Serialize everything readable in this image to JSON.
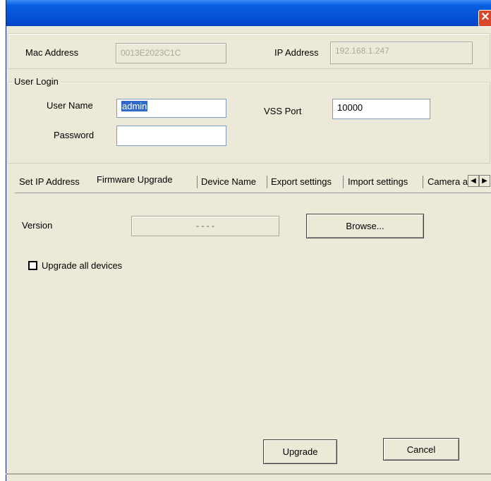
{
  "title_bar": {
    "close_glyph": "✕"
  },
  "device_info": {
    "mac_label": "Mac Address",
    "mac_value": "0013E2023C1C",
    "ip_label": "IP Address",
    "ip_value": "192.168.1.247"
  },
  "user_login": {
    "group_title": "User Login",
    "username_label": "User Name",
    "username_value": "admin",
    "password_label": "Password",
    "password_value": "",
    "vss_port_label": "VSS Port",
    "vss_port_value": "10000"
  },
  "tabs": [
    {
      "label": "Set IP Address",
      "active": false
    },
    {
      "label": "Firmware Upgrade",
      "active": true
    },
    {
      "label": "Device Name",
      "active": false
    },
    {
      "label": "Export settings",
      "active": false
    },
    {
      "label": "Import settings",
      "active": false
    },
    {
      "label": "Camera a",
      "active": false
    }
  ],
  "tab_scroll": {
    "left_glyph": "◀",
    "right_glyph": "▶"
  },
  "firmware": {
    "version_label": "Version",
    "version_value": "- - - -",
    "browse_label": "Browse...",
    "upgrade_all_label": "Upgrade all devices",
    "upgrade_all_checked": false
  },
  "actions": {
    "upgrade_label": "Upgrade",
    "cancel_label": "Cancel"
  }
}
